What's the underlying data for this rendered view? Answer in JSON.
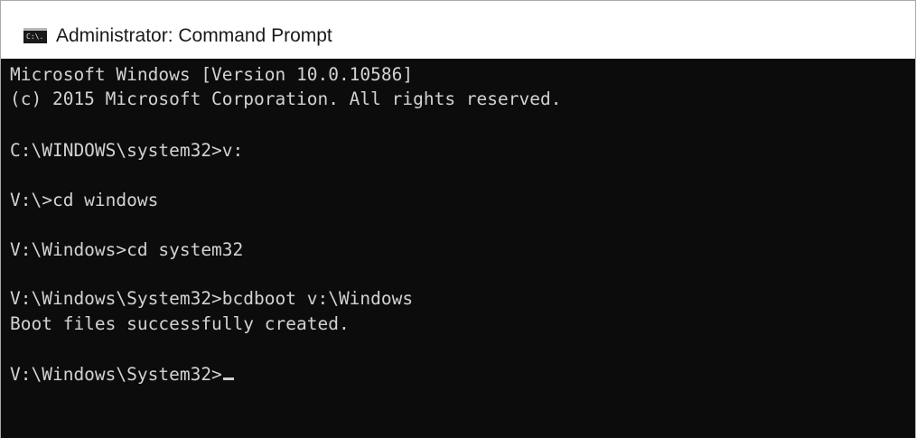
{
  "window": {
    "title": "Administrator: Command Prompt",
    "icon": "cmd-icon",
    "icon_glyph": "C:\\."
  },
  "console": {
    "lines": [
      "Microsoft Windows [Version 10.0.10586]",
      "(c) 2015 Microsoft Corporation. All rights reserved.",
      "C:\\WINDOWS\\system32>v:",
      "V:\\>cd windows",
      "V:\\Windows>cd system32",
      "V:\\Windows\\System32>bcdboot v:\\Windows",
      "Boot files successfully created.",
      "V:\\Windows\\System32>"
    ]
  },
  "colors": {
    "console_background": "#0c0c0c",
    "console_text": "#d2d2d2",
    "titlebar_background": "#ffffff"
  }
}
